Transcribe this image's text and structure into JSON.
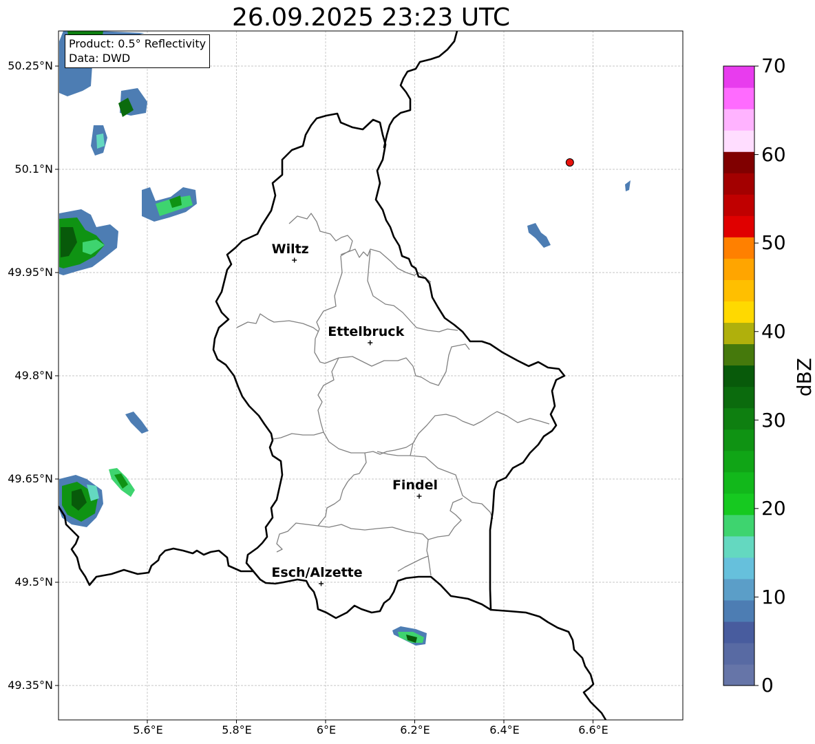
{
  "title": "26.09.2025 23:23 UTC",
  "infobox": {
    "product": "Product: 0.5° Reflectivity",
    "data": "Data: DWD"
  },
  "axes": {
    "lon_range": [
      5.4,
      6.8
    ],
    "lat_range": [
      49.3,
      50.3
    ],
    "lat_labels": [
      "50.25°N",
      "50.1°N",
      "49.95°N",
      "49.8°N",
      "49.65°N",
      "49.5°N",
      "49.35°N"
    ],
    "lon_labels": [
      "5.6°E",
      "5.8°E",
      "6°E",
      "6.2°E",
      "6.4°E",
      "6.6°E"
    ],
    "gridlines": true
  },
  "cities": [
    {
      "name": "Wiltz",
      "lon": 5.93,
      "lat": 49.968
    },
    {
      "name": "Ettelbruck",
      "lon": 6.1,
      "lat": 49.848
    },
    {
      "name": "Findel",
      "lon": 6.21,
      "lat": 49.625
    },
    {
      "name": "Esch/Alzette",
      "lon": 5.99,
      "lat": 49.498
    }
  ],
  "radar_site": {
    "lon": 6.548,
    "lat": 50.11,
    "color": "#e8120c"
  },
  "colorbar": {
    "label": "dBZ",
    "range": [
      0,
      70
    ],
    "tick_labels": [
      "70",
      "60",
      "50",
      "40",
      "30",
      "20",
      "10",
      "0"
    ],
    "colors": [
      "#6675a8",
      "#586aa3",
      "#485c9e",
      "#4d7db3",
      "#5b9ec8",
      "#66c0dc",
      "#64d8c0",
      "#3ed46f",
      "#16c920",
      "#12b81b",
      "#10a516",
      "#0f9313",
      "#0e7f10",
      "#0b6b0d",
      "#085a0a",
      "#45790c",
      "#b0b00c",
      "#ffd900",
      "#ffbf00",
      "#ffa500",
      "#ff8000",
      "#e00000",
      "#c00000",
      "#a30000",
      "#800000",
      "#ffddff",
      "#ffb3ff",
      "#ff6bff",
      "#e83cee"
    ]
  }
}
